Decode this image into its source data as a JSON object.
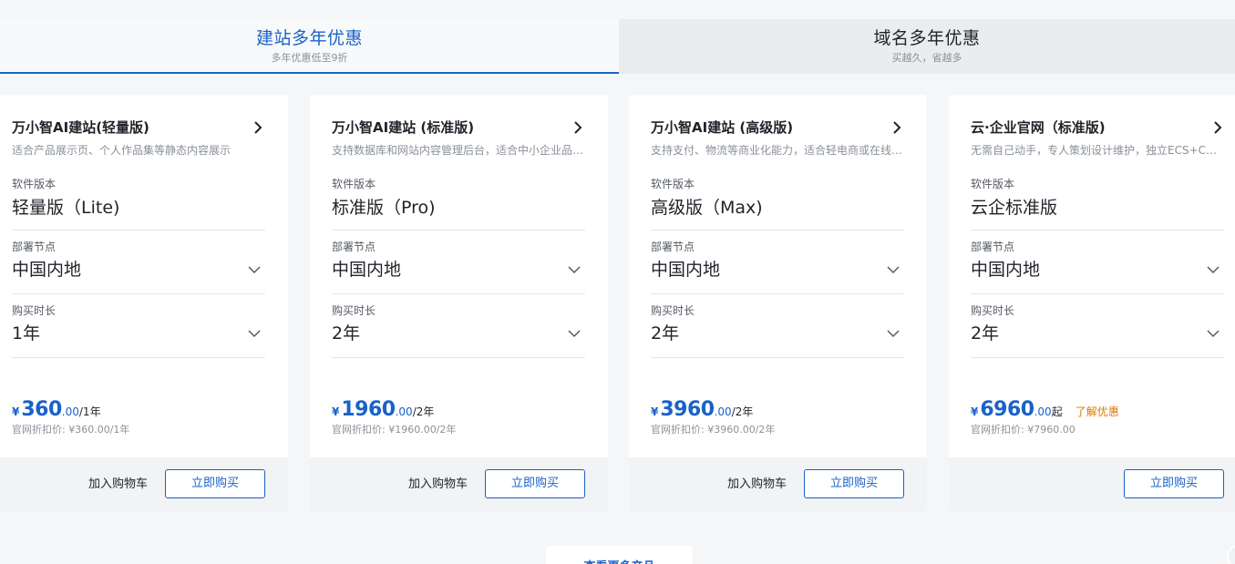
{
  "tabs": [
    {
      "title": "建站多年优惠",
      "subtitle": "多年优惠低至9折",
      "active": true
    },
    {
      "title": "域名多年优惠",
      "subtitle": "买越久，省越多",
      "active": false
    }
  ],
  "labels": {
    "version": "软件版本",
    "region": "部署节点",
    "duration": "购买时长",
    "cart": "加入购物车",
    "buy": "立即购买",
    "currency": "¥"
  },
  "cards": [
    {
      "title": "万小智AI建站(轻量版)",
      "desc": "适合产品展示页、个人作品集等静态内容展示",
      "version": "轻量版（Lite)",
      "region": "中国内地",
      "duration": "1年",
      "price_int": "360",
      "price_dec": ".00",
      "price_unit": "/1年",
      "orig_price": "官网折扣价: ¥360.00/1年",
      "show_cart": true
    },
    {
      "title": "万小智AI建站 (标准版)",
      "desc": "支持数据库和网站内容管理后台，适合中小企业品牌官网",
      "version": "标准版（Pro)",
      "region": "中国内地",
      "duration": "2年",
      "price_int": "1960",
      "price_dec": ".00",
      "price_unit": "/2年",
      "orig_price": "官网折扣价: ¥1960.00/2年",
      "show_cart": true
    },
    {
      "title": "万小智AI建站 (高级版)",
      "desc": "支持支付、物流等商业化能力，适合轻电商或在线交易场景",
      "version": "高级版（Max)",
      "region": "中国内地",
      "duration": "2年",
      "price_int": "3960",
      "price_dec": ".00",
      "price_unit": "/2年",
      "orig_price": "官网折扣价: ¥3960.00/2年",
      "show_cart": true
    },
    {
      "title": "云·企业官网（标准版)",
      "desc": "无需自己动手，专人策划设计维护，独立ECS+CDN部署",
      "version": "云企标准版",
      "region": "中国内地",
      "duration": "2年",
      "price_int": "6960",
      "price_dec": ".00",
      "price_unit": "起",
      "promo": "了解优惠",
      "orig_price": "官网折扣价: ¥7960.00",
      "show_cart": false
    }
  ],
  "more_button": "查看更多产品",
  "colors": {
    "accent": "#1a62c8",
    "promo": "#e07a00"
  }
}
